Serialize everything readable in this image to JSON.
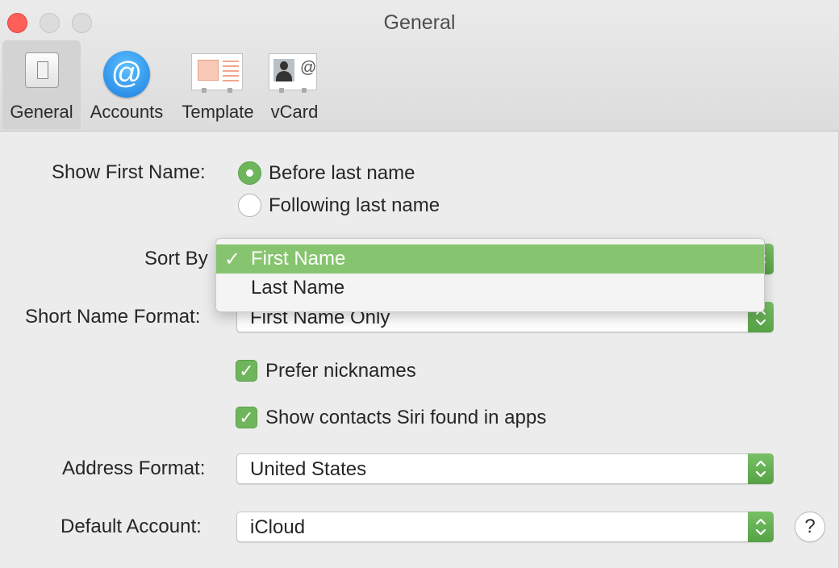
{
  "window": {
    "title": "General"
  },
  "toolbar": {
    "items": [
      {
        "label": "General",
        "icon": "general-icon",
        "selected": true
      },
      {
        "label": "Accounts",
        "icon": "at-sign-icon"
      },
      {
        "label": "Template",
        "icon": "template-icon"
      },
      {
        "label": "vCard",
        "icon": "vcard-icon"
      }
    ]
  },
  "show_first_name": {
    "label": "Show First Name:",
    "options": [
      {
        "label": "Before last name",
        "selected": true
      },
      {
        "label": "Following last name",
        "selected": false
      }
    ]
  },
  "sort_by": {
    "label": "Sort By",
    "menu_items": [
      {
        "label": "First Name",
        "checked": true,
        "check_mark": "✓"
      },
      {
        "label": "Last Name",
        "checked": false
      }
    ]
  },
  "short_name_format": {
    "label": "Short Name Format:",
    "value": "First Name Only"
  },
  "checkboxes": {
    "prefer_nicknames": {
      "label": "Prefer nicknames",
      "checked": true
    },
    "show_siri_contacts": {
      "label": "Show contacts Siri found in apps",
      "checked": true
    }
  },
  "address_format": {
    "label": "Address Format:",
    "value": "United States"
  },
  "default_account": {
    "label": "Default Account:",
    "value": "iCloud"
  },
  "help": {
    "symbol": "?"
  },
  "colors": {
    "accent": "#6eb55c",
    "menu_highlight": "#87c46f",
    "close_button": "#fe5f57"
  }
}
